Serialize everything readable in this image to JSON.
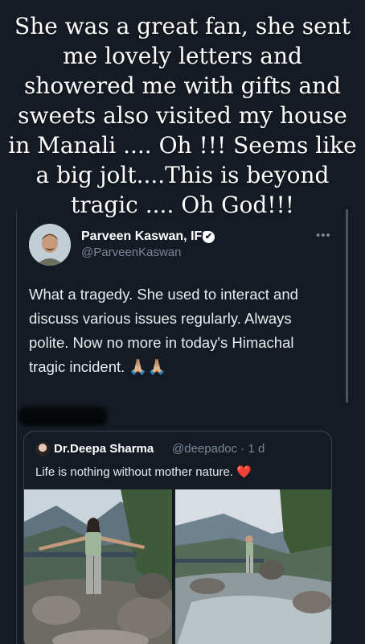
{
  "story": {
    "caption": "She was a great fan, she sent me lovely letters and showered me with gifts and sweets also visited my house in Manali .... Oh !!! Seems like a big jolt....This is beyond tragic .... Oh God!!!"
  },
  "tweet": {
    "author_name": "Parveen Kaswan, IFS",
    "author_handle": "@ParveenKaswan",
    "verified_icon": "✔",
    "more_icon": "•••",
    "text": "What a tragedy. She used to interact and discuss various issues regularly. Always polite. Now no more in today's Himachal tragic incident. 🙏🏼🙏🏼"
  },
  "quoted_tweet": {
    "author_name": "Dr.Deepa Sharma",
    "meta": "@deepadoc · 1 d",
    "text": "Life is nothing without mother nature.",
    "heart": "❤️"
  },
  "colors": {
    "background": "#151b24",
    "text": "#e8ebee",
    "muted": "#7b8794",
    "heart": "#e02424"
  }
}
